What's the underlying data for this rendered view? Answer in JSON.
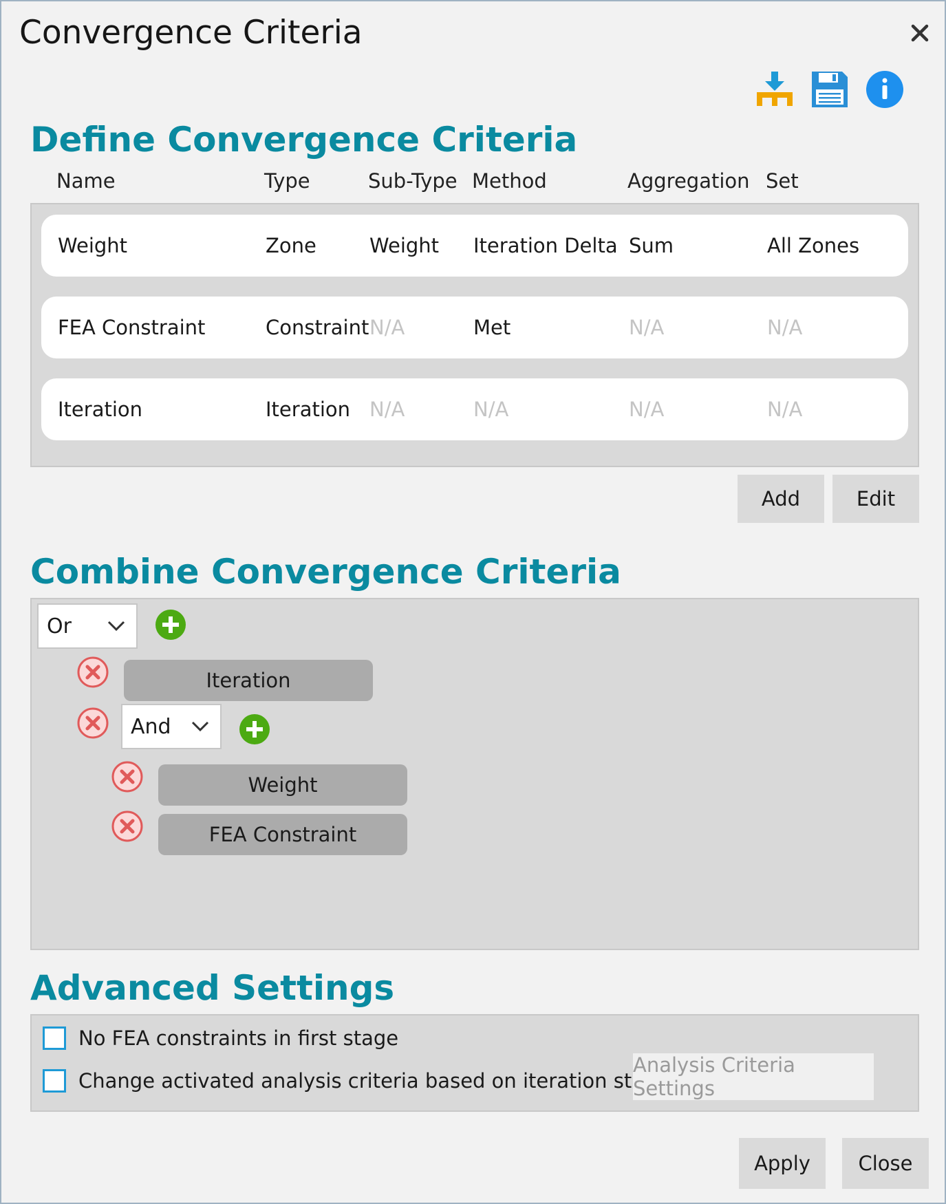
{
  "window": {
    "title": "Convergence Criteria"
  },
  "define": {
    "title": "Define Convergence Criteria",
    "columns": [
      "Name",
      "Type",
      "Sub-Type",
      "Method",
      "Aggregation",
      "Set"
    ],
    "rows": [
      {
        "name": "Weight",
        "type": "Zone",
        "subtype": "Weight",
        "method": "Iteration Delta",
        "aggregation": "Sum",
        "set": "All Zones"
      },
      {
        "name": "FEA Constraint",
        "type": "Constraint",
        "subtype": "N/A",
        "method": "Met",
        "aggregation": "N/A",
        "set": "N/A"
      },
      {
        "name": "Iteration",
        "type": "Iteration",
        "subtype": "N/A",
        "method": "N/A",
        "aggregation": "N/A",
        "set": "N/A"
      }
    ],
    "add_label": "Add",
    "edit_label": "Edit"
  },
  "combine": {
    "title": "Combine Convergence Criteria",
    "root_operator": "Or",
    "root_items": [
      {
        "label": "Iteration"
      }
    ],
    "nested_operator": "And",
    "nested_items": [
      {
        "label": "Weight"
      },
      {
        "label": "FEA Constraint"
      }
    ]
  },
  "advanced": {
    "title": "Advanced Settings",
    "option1": "No FEA constraints in first stage",
    "option2": "Change activated analysis criteria based on iteration stage",
    "settings_button": "Analysis Criteria Settings"
  },
  "footer": {
    "apply_label": "Apply",
    "close_label": "Close"
  },
  "icons": {
    "import": "import-icon",
    "save": "save-icon",
    "info": "info-icon",
    "add": "add-icon",
    "remove": "remove-icon"
  },
  "colors": {
    "section_title": "#0a8aa0",
    "add_green": "#4caa12",
    "remove_red": "#e05a5a",
    "info_blue": "#1e90ee",
    "save_blue": "#2a8fd6",
    "import_orange": "#f0a500"
  }
}
